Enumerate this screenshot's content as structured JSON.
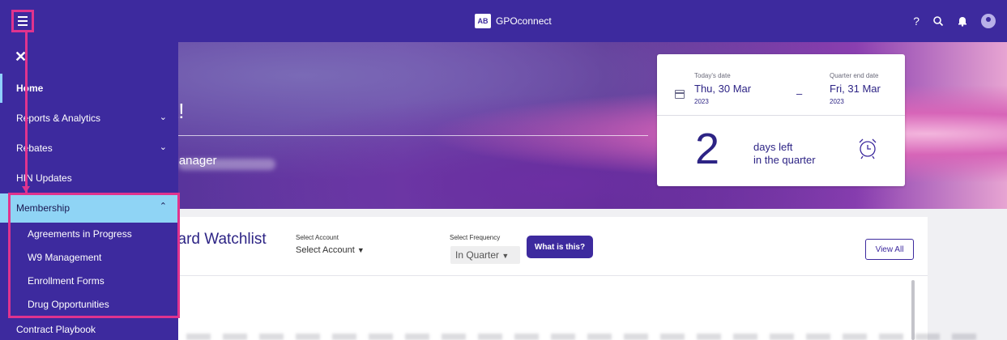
{
  "topbar": {
    "brand_logo": "AB",
    "brand_name": "GPOconnect",
    "icons": [
      "help-icon",
      "search-icon",
      "bell-icon",
      "user-avatar-icon"
    ],
    "help_glyph": "?"
  },
  "hero": {
    "title": "st!",
    "role": "t Manager"
  },
  "date_card": {
    "today_label": "Today's date",
    "today_value": "Thu, 30 Mar",
    "today_year": "2023",
    "dash": "–",
    "quarter_end_label": "Quarter end date",
    "quarter_end_value": "Fri, 31 Mar",
    "quarter_end_year": "2023",
    "days_left_number": "2",
    "days_left_line1": "days left",
    "days_left_line2": "in the quarter"
  },
  "watchlist": {
    "title": "card Watchlist",
    "account_label": "Select Account",
    "account_value": "Select Account",
    "frequency_label": "Select Frequency",
    "frequency_value": "In Quarter",
    "what_button": "What is this?",
    "view_all_button": "View All"
  },
  "sidebar": {
    "close_glyph": "✕",
    "items": [
      {
        "label": "Home",
        "active": true
      },
      {
        "label": "Reports & Analytics",
        "chevron": "down"
      },
      {
        "label": "Rebates",
        "chevron": "down"
      },
      {
        "label": "HIN Updates"
      }
    ],
    "membership": {
      "label": "Membership",
      "chevron": "up"
    },
    "membership_sub": [
      "Agreements in Progress",
      "W9 Management",
      "Enrollment Forms",
      "Drug Opportunities"
    ],
    "contract_playbook": "Contract Playbook"
  },
  "colors": {
    "brand": "#3d2a9e",
    "highlight": "#e0338e",
    "membership_bg": "#8fd4f5"
  }
}
